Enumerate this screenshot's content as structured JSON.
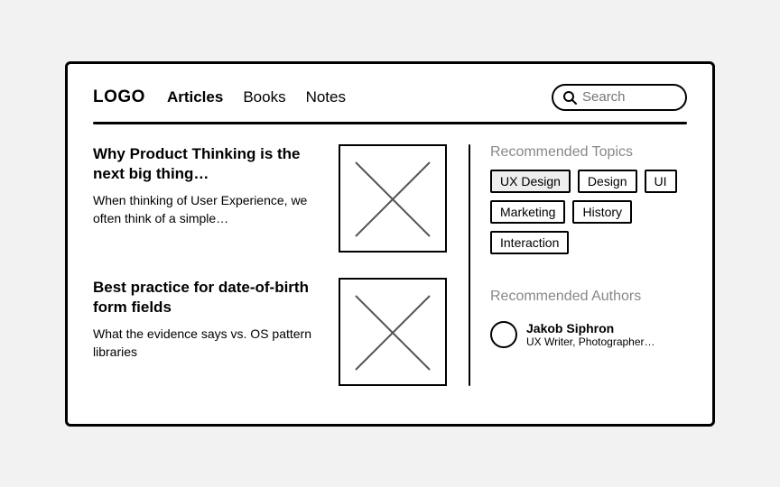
{
  "logo": "LOGO",
  "nav": {
    "items": [
      {
        "label": "Articles",
        "active": true
      },
      {
        "label": "Books",
        "active": false
      },
      {
        "label": "Notes",
        "active": false
      }
    ]
  },
  "search": {
    "placeholder": "Search"
  },
  "articles": [
    {
      "title": "Why Product Thinking is the next big thing…",
      "excerpt": "When thinking of User Experience, we often think of a simple…"
    },
    {
      "title": "Best practice for date-of-birth form fields",
      "excerpt": "What the evidence says vs. OS pattern libraries"
    }
  ],
  "sidebar": {
    "topics_heading": "Recommended Topics",
    "topics": [
      {
        "label": "UX Design",
        "selected": true
      },
      {
        "label": "Design",
        "selected": false
      },
      {
        "label": "UI",
        "selected": false
      },
      {
        "label": "Marketing",
        "selected": false
      },
      {
        "label": "History",
        "selected": false
      },
      {
        "label": "Interaction",
        "selected": false
      }
    ],
    "authors_heading": "Recommended Authors",
    "authors": [
      {
        "name": "Jakob Siphron",
        "bio": "UX Writer, Photographer…"
      }
    ]
  }
}
